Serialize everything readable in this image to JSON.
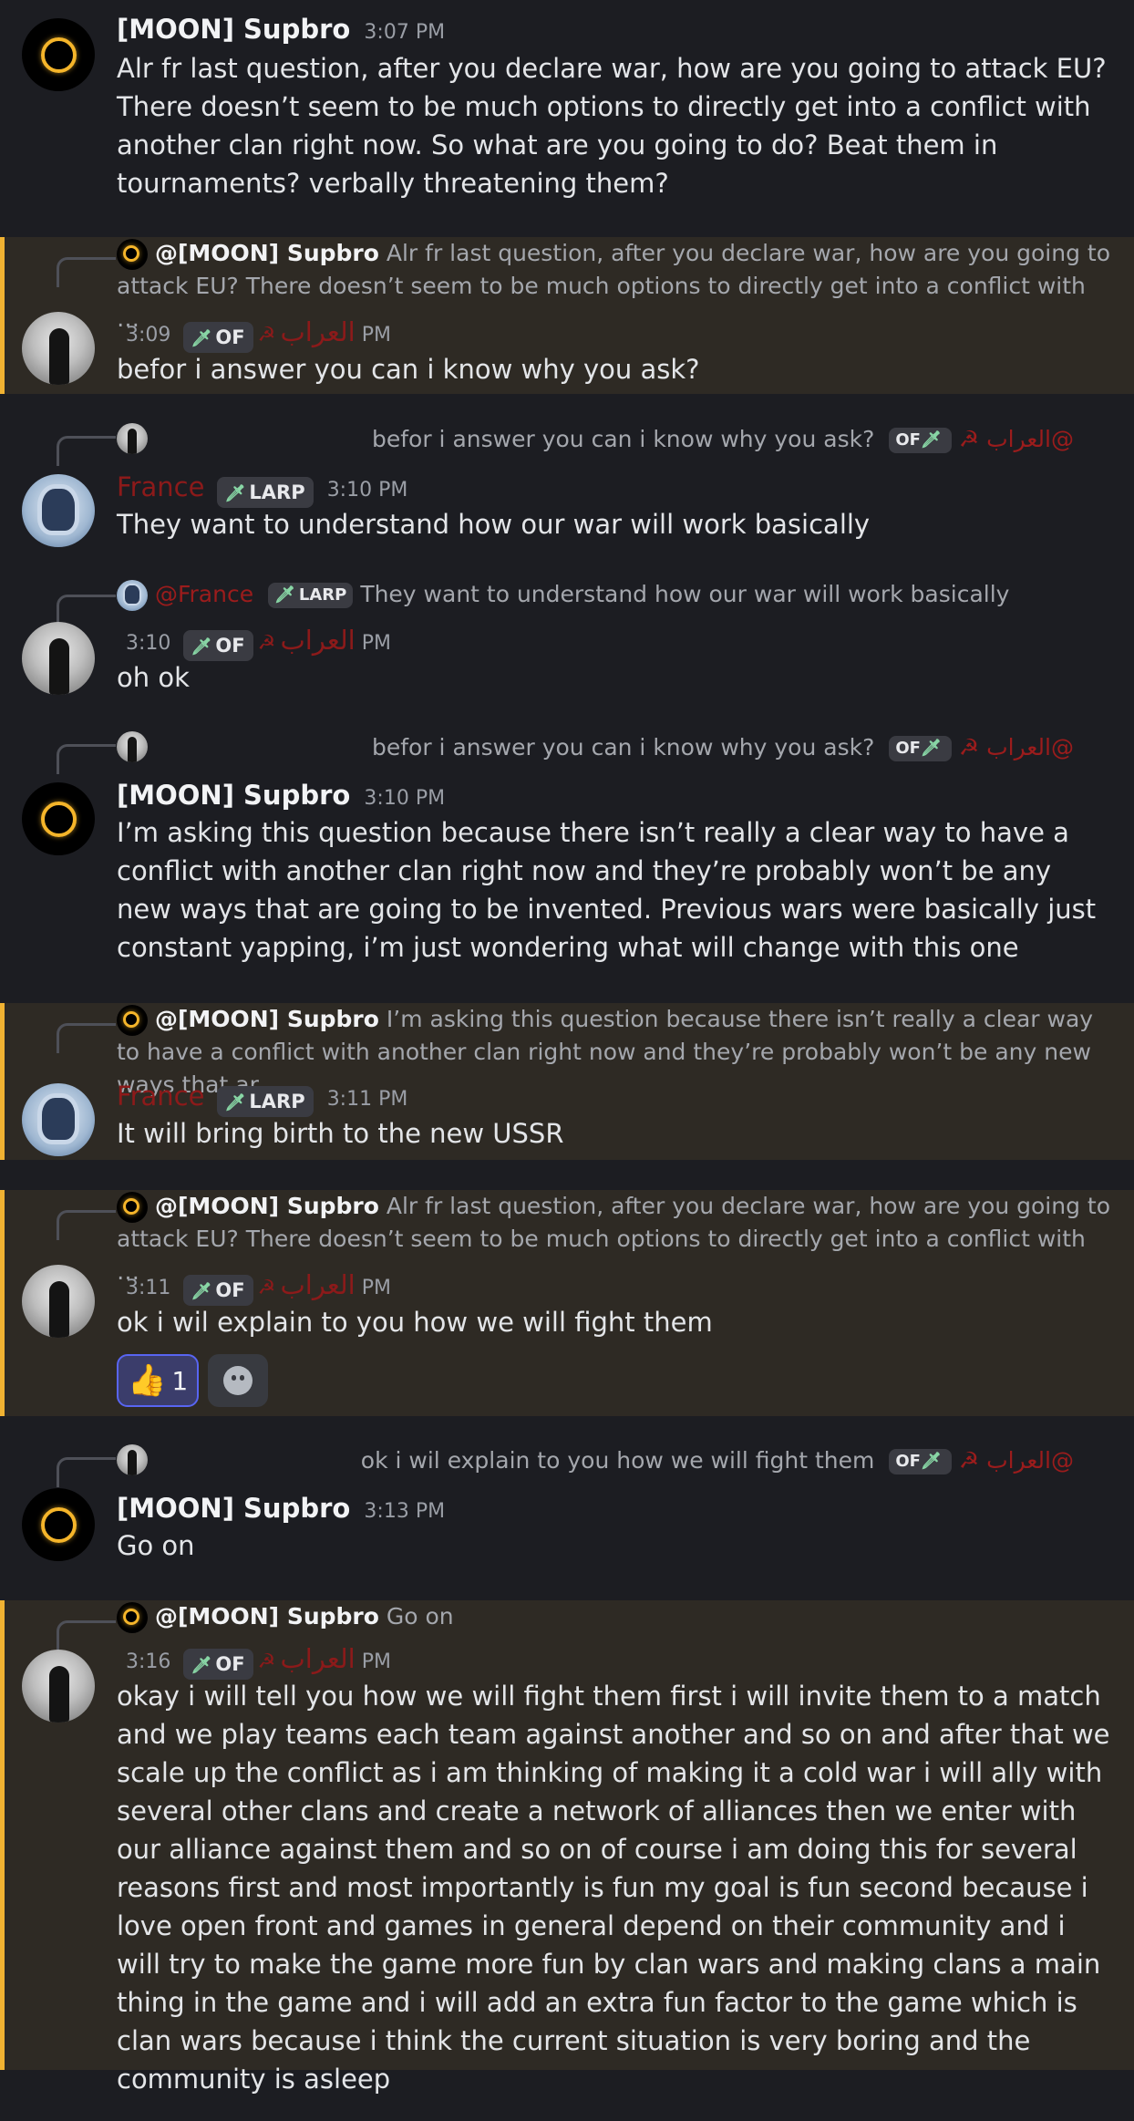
{
  "users": {
    "supbro": "[MOON] Supbro",
    "arab": "العراب",
    "france": "France"
  },
  "glyphs": {
    "sickle": "☭",
    "role_icon": "🗡"
  },
  "roles": {
    "of": "OF",
    "larp": "LARP"
  },
  "messages": [
    {
      "id": "m1",
      "author": "[MOON] Supbro",
      "time": "3:07 PM",
      "text": "Alr fr last question, after you declare war, how are you going to attack EU? There doesn’t seem to be much options to directly get into a conflict with another clan right now. So what are you going to do? Beat them in tournaments? verbally threatening them?"
    },
    {
      "id": "m2",
      "reply_name": "@[MOON] Supbro",
      "reply_text": "Alr fr last question, after you declare war, how are you going to attack EU? There doesn’t seem to be much options to directly get into a conflict with …",
      "author": "العراب",
      "role": "OF",
      "time": "3:09 PM",
      "text": "befor i answer you can i know why you ask?"
    },
    {
      "id": "m3",
      "reply_name": "@العراب ☭",
      "reply_text": "?befor i answer you can i know why you ask",
      "author": "France",
      "role": "LARP",
      "time": "3:10 PM",
      "text": "They want to understand how our war will work basically"
    },
    {
      "id": "m4",
      "reply_name": "@France",
      "reply_role": "LARP",
      "reply_text": "They want to understand how our war will work basically",
      "author": "العراب",
      "role": "OF",
      "time": "3:10 PM",
      "text": "oh ok"
    },
    {
      "id": "m5",
      "reply_name": "@العراب ☭",
      "reply_text": "?befor i answer you can i know why you ask",
      "author": "[MOON] Supbro",
      "time": "3:10 PM",
      "text": "I’m asking this question because there isn’t really a clear way to have a conflict with another clan right now and they’re probably won’t be any new ways that are going to be invented. Previous wars were basically just constant yapping, i’m just wondering what will change with this one"
    },
    {
      "id": "m6",
      "reply_name": "@[MOON] Supbro",
      "reply_text": "I’m asking this question because there isn’t really a clear way to have a conflict with another clan right now and they’re probably won’t be any new ways that ar…",
      "author": "France",
      "role": "LARP",
      "time": "3:11 PM",
      "text": "It will bring birth to the new USSR"
    },
    {
      "id": "m7",
      "reply_name": "@[MOON] Supbro",
      "reply_text": "Alr fr last question, after you declare war, how are you going to attack EU? There doesn’t seem to be much options to directly get into a conflict with …",
      "author": "العراب",
      "role": "OF",
      "time": "3:11 PM",
      "text": "ok i wil explain to you how we will fight them",
      "reaction_emoji": "👍",
      "reaction_count": "1"
    },
    {
      "id": "m8",
      "reply_name": "@العراب ☭",
      "reply_text": "ok i wil explain to you how we will fight them",
      "author": "[MOON] Supbro",
      "time": "3:13 PM",
      "text": "Go on"
    },
    {
      "id": "m9",
      "reply_name": "@[MOON] Supbro",
      "reply_text": "Go on",
      "author": "العراب",
      "role": "OF",
      "time": "3:16 PM",
      "text": "okay i will tell you how we will fight them first i will invite them to a match and we play teams each team against another and so on and after that we scale up the conflict as i am thinking of making it a cold war i will ally with several other clans and create a network of alliances then we enter with our alliance against them and so on of course i am doing this for several reasons first and most importantly is fun my goal is fun second because i love open front and games in general depend on their community and i will try to make the game more fun by clan wars and making clans a main thing in the game and i will add an extra fun factor to the game which is clan wars because i think the current situation is very boring and the community is asleep"
    }
  ],
  "colors": {
    "background": "#1c1d22",
    "highlight": "#2e2a24",
    "highlight_bar": "#f0b232",
    "arab_name": "#8c1a1a",
    "france_name": "#8c1a1a"
  }
}
